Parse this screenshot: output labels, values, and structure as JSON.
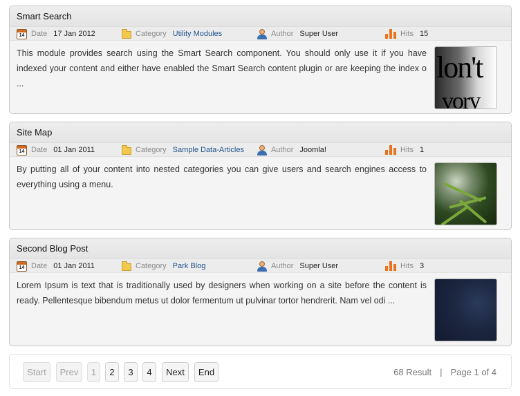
{
  "meta_labels": {
    "date": "Date",
    "category": "Category",
    "author": "Author",
    "hits": "Hits"
  },
  "calendar_day": "14",
  "articles": [
    {
      "title": "Smart Search",
      "date": "17 Jan 2012",
      "category": "Utility Modules",
      "author": "Super User",
      "hits": "15",
      "text": "This module provides search using the Smart Search component. You should only use it if you have indexed your content and either have enabled the Smart Search content plugin or are keeping the index o ...",
      "thumb_text_line1": "lon't",
      "thumb_text_line2": "vory"
    },
    {
      "title": "Site Map",
      "date": "01 Jan 2011",
      "category": "Sample Data-Articles",
      "author": "Joomla!",
      "hits": "1",
      "text": "By putting all of your content into nested categories you can give users and search engines access to everything using a menu."
    },
    {
      "title": "Second Blog Post",
      "date": "01 Jan 2011",
      "category": "Park Blog",
      "author": "Super User",
      "hits": "3",
      "text": "Lorem Ipsum is text that is traditionally used by designers when working on a site before the content is ready. Pellentesque bibendum metus ut dolor fermentum ut pulvinar tortor hendrerit. Nam vel odi ..."
    }
  ],
  "pagination": {
    "start": "Start",
    "prev": "Prev",
    "pages": [
      "1",
      "2",
      "3",
      "4"
    ],
    "next": "Next",
    "end": "End",
    "results": "68 Result",
    "separator": "|",
    "page_info": "Page 1 of 4"
  },
  "icons": [
    "calendar-icon",
    "folder-icon",
    "user-icon",
    "bar-chart-icon"
  ],
  "colors": {
    "link": "#21558f",
    "hits_icon": "#e8731e",
    "disabled_text": "#a4a4a4"
  }
}
